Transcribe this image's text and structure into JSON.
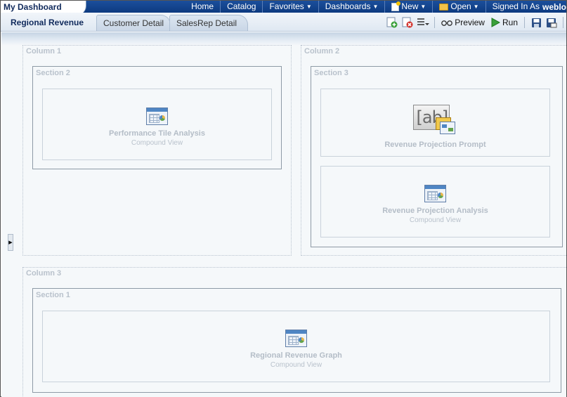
{
  "header": {
    "dashboard_title": "My Dashboard",
    "nav": {
      "home": "Home",
      "catalog": "Catalog",
      "favorites": "Favorites",
      "dashboards": "Dashboards",
      "new": "New",
      "open": "Open",
      "signed_in_as": "Signed In As",
      "user": "weblo"
    }
  },
  "tabs": [
    {
      "label": "Regional Revenue"
    },
    {
      "label": "Customer Detail"
    },
    {
      "label": "SalesRep Detail"
    }
  ],
  "toolbar": {
    "preview_label": "Preview",
    "run_label": "Run"
  },
  "layout": {
    "column1": {
      "label": "Column 1",
      "section": {
        "label": "Section 2",
        "views": [
          {
            "title": "Performance Tile Analysis",
            "subtitle": "Compound View"
          }
        ]
      }
    },
    "column2": {
      "label": "Column 2",
      "section": {
        "label": "Section 3",
        "views": [
          {
            "title": "Revenue Projection Prompt"
          },
          {
            "title": "Revenue Projection Analysis",
            "subtitle": "Compound View"
          }
        ]
      }
    },
    "column3": {
      "label": "Column 3",
      "section": {
        "label": "Section 1",
        "views": [
          {
            "title": "Regional Revenue Graph",
            "subtitle": "Compound View"
          }
        ]
      }
    },
    "prompt_icon_text": "[ab]"
  }
}
